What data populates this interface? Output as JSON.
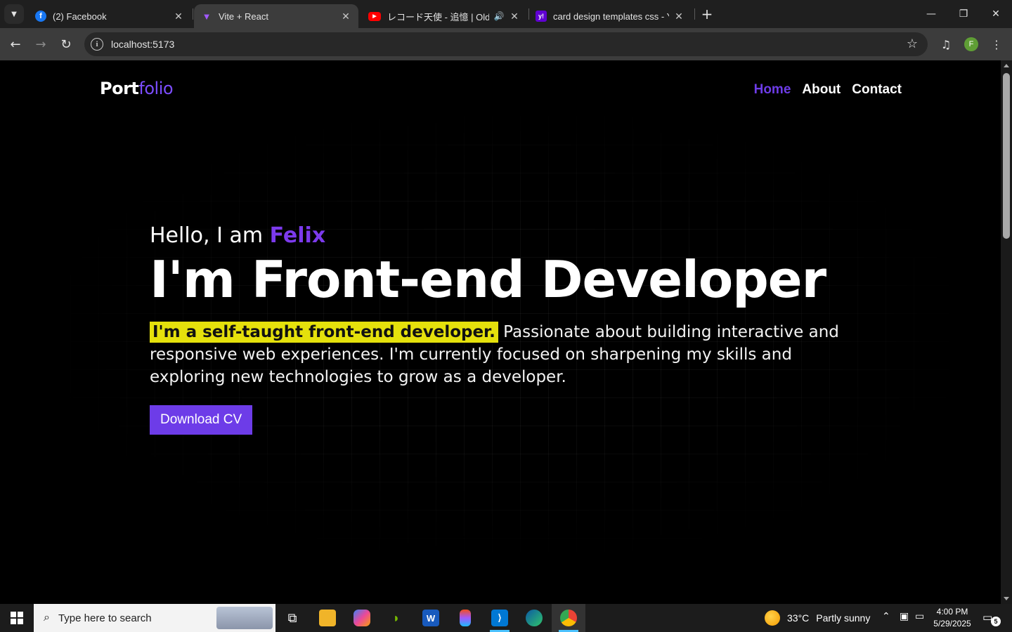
{
  "browser": {
    "tabs": [
      {
        "title": "(2) Facebook",
        "favicon": "facebook-icon",
        "color": "#1877f2",
        "glyph": "f"
      },
      {
        "title": "Vite + React",
        "favicon": "vite-icon",
        "color": "#a259ff",
        "glyph": "▼",
        "active": true
      },
      {
        "title": "レコード天使 - 追憶 | Old Lo-f",
        "favicon": "youtube-icon",
        "color": "#ff0000",
        "glyph": "▶"
      },
      {
        "title": "card design templates css - Yah",
        "favicon": "yahoo-icon",
        "color": "#6001d2",
        "glyph": "y!"
      }
    ],
    "url": "localhost:5173",
    "profile_initial": "F"
  },
  "page": {
    "logo": {
      "part1": "Port",
      "part2": "folio"
    },
    "nav": [
      {
        "label": "Home",
        "active": true
      },
      {
        "label": "About"
      },
      {
        "label": "Contact"
      }
    ],
    "hero": {
      "greeting": "Hello, I am ",
      "name": "Felix",
      "headline": "I'm Front-end Developer",
      "highlight": "I'm a self-taught front-end developer.",
      "bio": " Passionate about building interactive and responsive web experiences. I'm currently focused on sharpening my skills and exploring new technologies to grow as a developer.",
      "cta": "Download CV"
    },
    "colors": {
      "accent": "#6d3ce8",
      "highlight": "#e5e10c"
    }
  },
  "taskbar": {
    "search_placeholder": "Type here to search",
    "weather": {
      "temp": "33°C",
      "condition": "Partly sunny"
    },
    "clock": {
      "time": "4:00 PM",
      "date": "5/29/2025"
    },
    "notifications": "5"
  }
}
